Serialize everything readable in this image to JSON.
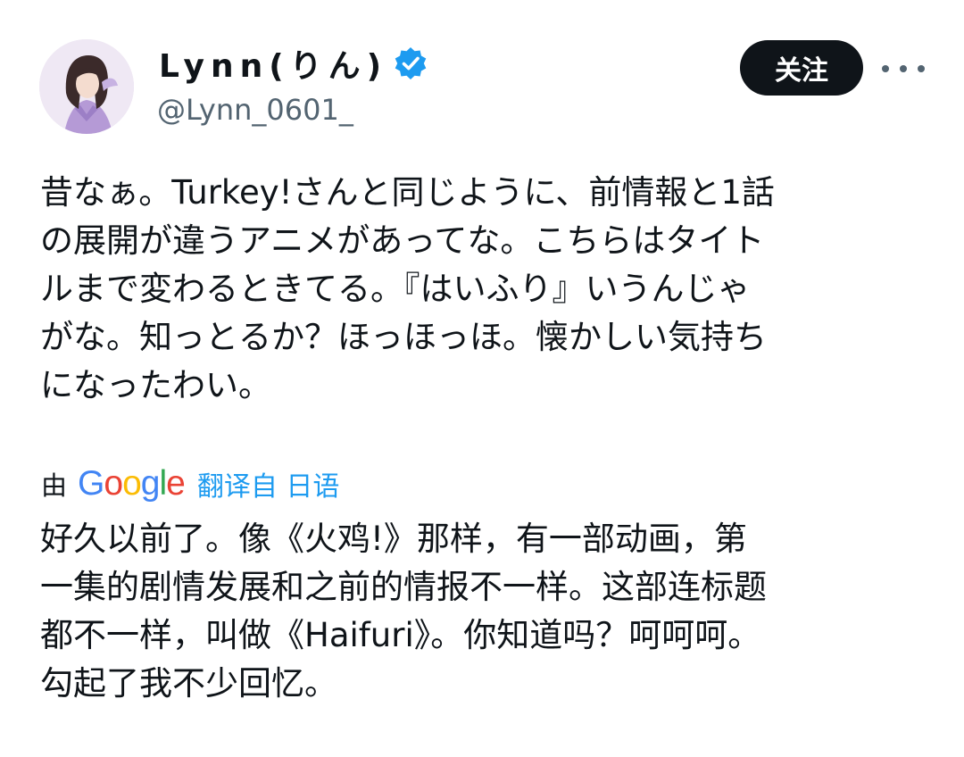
{
  "header": {
    "display_name": "Lynn(りん)",
    "handle": "@Lynn_0601_",
    "follow_label": "关注",
    "verified_color": "#1d9bf0",
    "icons": {
      "avatar": "profile-photo",
      "verified": "verified-badge-icon",
      "more": "more-horizontal-icon"
    }
  },
  "tweet": {
    "lines": [
      "昔なぁ。Turkey!さんと同じように、前情報と1話",
      "の展開が違うアニメがあってな。こちらはタイト",
      "ルまで変わるときてる。『はいふり』いうんじゃ",
      "がな。知っとるか？ほっほっほ。懐かしい気持ち",
      "になったわい。"
    ]
  },
  "translation": {
    "by": "由",
    "provider_letters": [
      "G",
      "o",
      "o",
      "g",
      "l",
      "e"
    ],
    "translated_from": "翻译自 日语",
    "lines": [
      "好久以前了。像《火鸡!》那样，有一部动画，第",
      "一集的剧情发展和之前的情报不一样。这部连标题",
      "都不一样，叫做《Haifuri》。你知道吗？呵呵呵。",
      "勾起了我不少回忆。"
    ]
  },
  "colors": {
    "text": "#0f1419",
    "secondary": "#536471",
    "link": "#1d9bf0",
    "button_bg": "#0f1419",
    "button_text": "#ffffff"
  }
}
